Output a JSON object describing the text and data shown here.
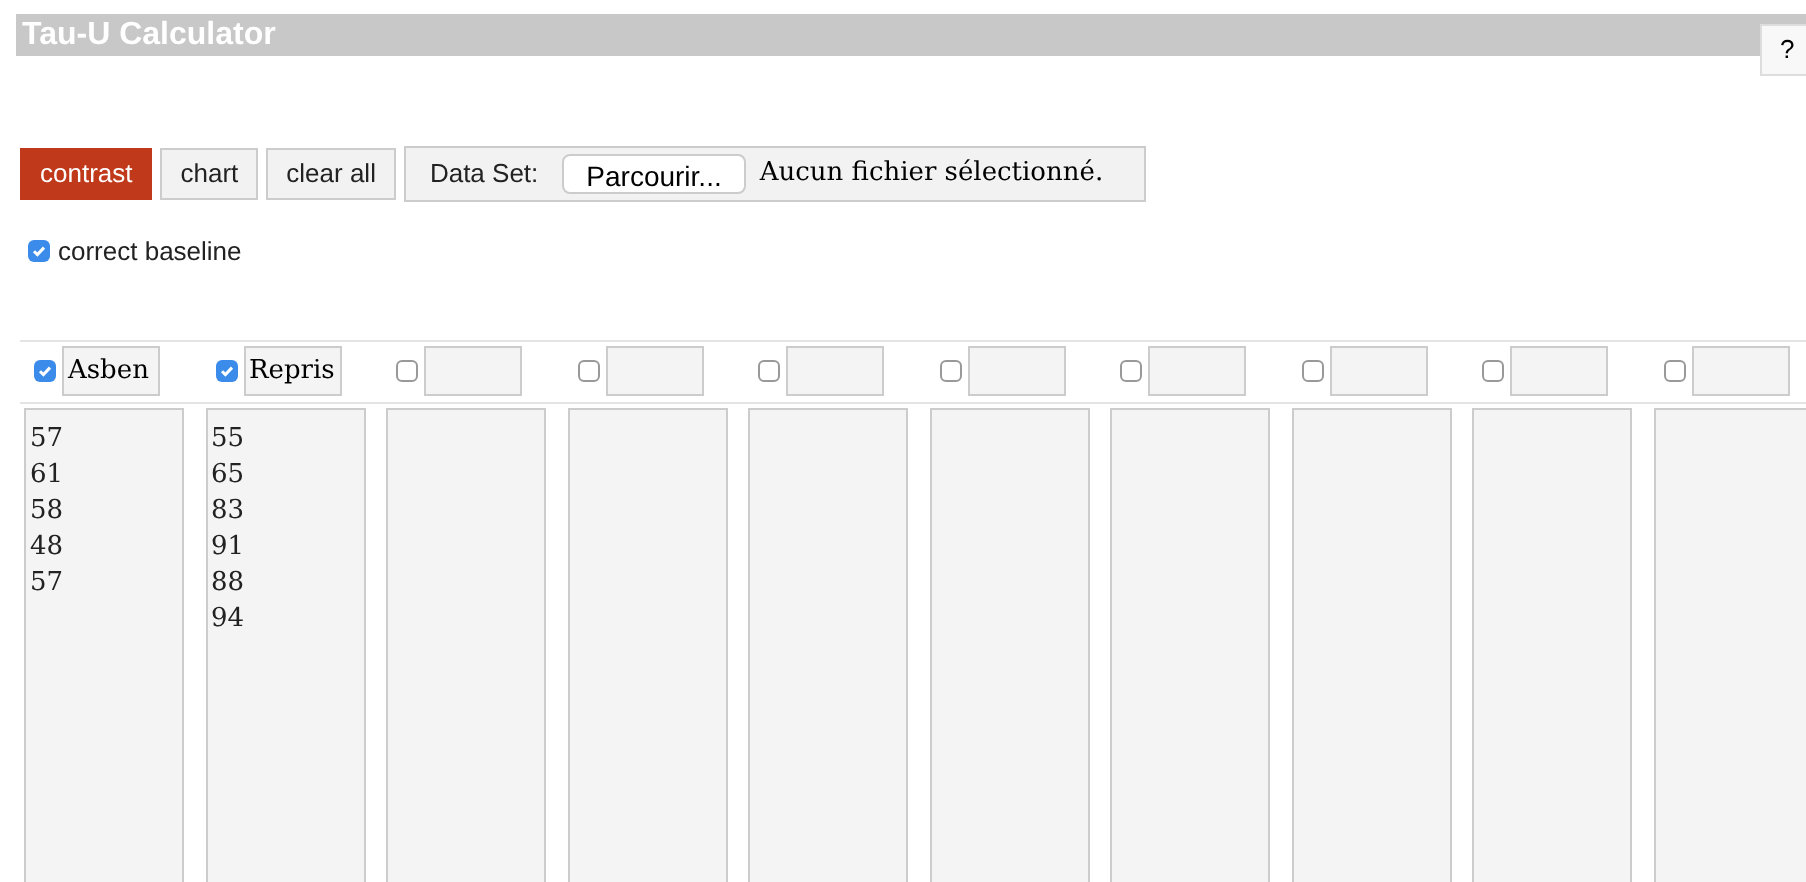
{
  "title": "Tau-U Calculator",
  "help_button": "?",
  "toolbar": {
    "buttons": [
      {
        "label": "contrast",
        "selected": true
      },
      {
        "label": "chart",
        "selected": false
      },
      {
        "label": "clear all",
        "selected": false
      }
    ],
    "data_set": {
      "label": "Data Set:",
      "browse_button": "Parcourir...",
      "file_status": "Aucun fichier sélectionné."
    }
  },
  "correct_baseline": {
    "label": "correct baseline",
    "checked": true
  },
  "columns": [
    {
      "checked": true,
      "name": "Asben",
      "values": [
        "57",
        "61",
        "58",
        "48",
        "57"
      ]
    },
    {
      "checked": true,
      "name": "Repris",
      "values": [
        "55",
        "65",
        "83",
        "91",
        "88",
        "94"
      ]
    },
    {
      "checked": false
    },
    {
      "checked": false
    },
    {
      "checked": false
    },
    {
      "checked": false
    },
    {
      "checked": false
    },
    {
      "checked": false
    },
    {
      "checked": false
    },
    {
      "checked": false
    }
  ]
}
